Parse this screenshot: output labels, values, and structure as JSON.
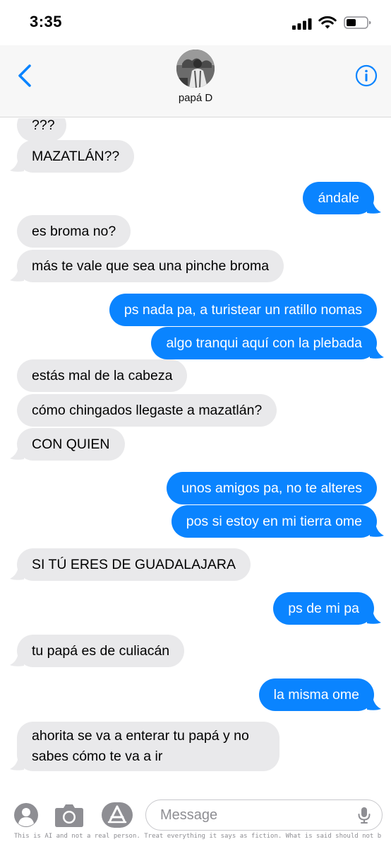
{
  "status_bar": {
    "time": "3:35"
  },
  "header": {
    "contact_name": "papá D"
  },
  "messages": [
    {
      "side": "recv",
      "text": "???"
    },
    {
      "side": "recv",
      "text": "MAZATLÁN??"
    },
    {
      "side": "sent",
      "text": "ándale"
    },
    {
      "side": "recv",
      "text": "es broma no?"
    },
    {
      "side": "recv",
      "text": "más te vale que sea una pinche broma"
    },
    {
      "side": "sent",
      "text": "ps nada pa, a turistear un ratillo nomas"
    },
    {
      "side": "sent",
      "text": "algo tranqui aquí con la plebada"
    },
    {
      "side": "recv",
      "text": "estás mal de la cabeza"
    },
    {
      "side": "recv",
      "text": "cómo chingados llegaste a mazatlán?"
    },
    {
      "side": "recv",
      "text": "CON QUIEN"
    },
    {
      "side": "sent",
      "text": "unos amigos pa, no te alteres"
    },
    {
      "side": "sent",
      "text": "pos si estoy en mi tierra ome"
    },
    {
      "side": "recv",
      "text": "SI TÚ ERES DE GUADALAJARA"
    },
    {
      "side": "sent",
      "text": "ps de mi pa"
    },
    {
      "side": "recv",
      "text": "tu papá es de culiacán"
    },
    {
      "side": "sent",
      "text": "la misma ome"
    },
    {
      "side": "recv",
      "text": "ahorita se va a enterar tu papá y no sabes cómo te va a ir"
    }
  ],
  "composer": {
    "placeholder": "Message",
    "disclaimer": "This is AI and not a real person. Treat everything it says as fiction. What is said should not be relie..."
  },
  "colors": {
    "sent_bubble": "#0a84ff",
    "recv_bubble": "#e9e9eb",
    "accent": "#0a84ff"
  },
  "icons": [
    "back-chevron-icon",
    "info-icon",
    "contact-icon",
    "camera-icon",
    "app-store-icon",
    "microphone-icon"
  ]
}
